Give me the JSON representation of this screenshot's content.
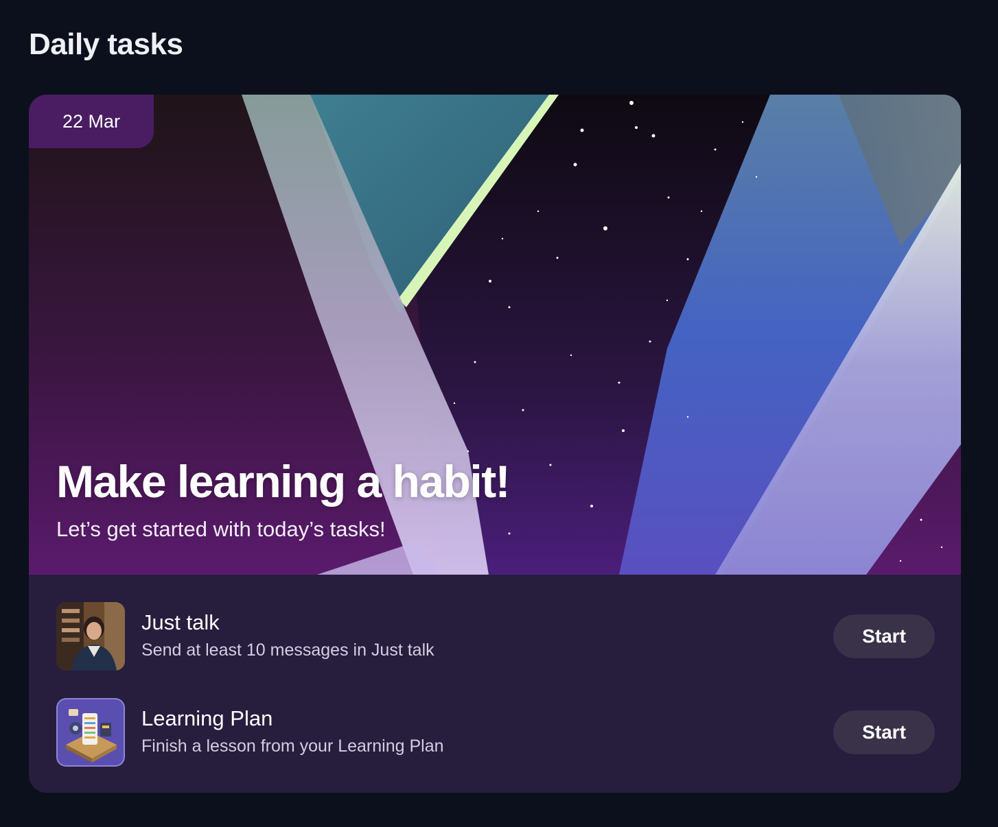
{
  "page": {
    "title": "Daily tasks"
  },
  "hero": {
    "date": "22 Mar",
    "title": "Make learning a habit!",
    "subtitle": "Let’s get started with today’s tasks!"
  },
  "tasks": [
    {
      "title": "Just talk",
      "description": "Send at least 10 messages in Just talk",
      "button_label": "Start",
      "icon": "portrait-thumbnail"
    },
    {
      "title": "Learning Plan",
      "description": "Finish a lesson from your Learning Plan",
      "button_label": "Start",
      "icon": "learning-plan-illustration"
    }
  ],
  "colors": {
    "background": "#0b101c",
    "card": "#271d3d",
    "date_badge": "#4a1d63",
    "button": "#3a3249"
  }
}
